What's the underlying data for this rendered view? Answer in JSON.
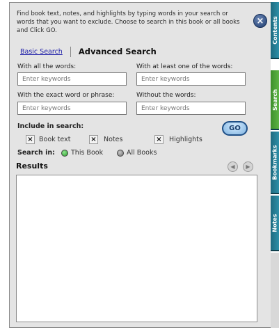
{
  "intro_text": "Find book text, notes, and highlights by typing words in your search or words that you want to exclude. Choose to search in this book or all books and Click GO.",
  "close_label": "×",
  "modes": {
    "basic": "Basic Search",
    "advanced": "Advanced Search"
  },
  "fields": {
    "all_words": {
      "label": "With all the words:",
      "placeholder": "Enter keywords"
    },
    "one_of_words": {
      "label": "With at least one of the words:",
      "placeholder": "Enter keywords"
    },
    "exact_phrase": {
      "label": "With the exact word or phrase:",
      "placeholder": "Enter keywords"
    },
    "without_words": {
      "label": "Without the words:",
      "placeholder": "Enter keywords"
    }
  },
  "include": {
    "label": "Include in search:",
    "options": [
      {
        "label": "Book text",
        "checked": true,
        "mark": "×"
      },
      {
        "label": "Notes",
        "checked": true,
        "mark": "×"
      },
      {
        "label": "Highlights",
        "checked": true,
        "mark": "×"
      }
    ]
  },
  "go_label": "GO",
  "search_in": {
    "label": "Search in:",
    "options": [
      {
        "label": "This Book",
        "selected": true
      },
      {
        "label": "All Books",
        "selected": false
      }
    ]
  },
  "results": {
    "label": "Results",
    "prev_glyph": "◀",
    "next_glyph": "▶"
  },
  "side_tabs": [
    {
      "label": "Contents",
      "active": false
    },
    {
      "label": "Search",
      "active": true
    },
    {
      "label": "Bookmarks",
      "active": false
    },
    {
      "label": "Notes",
      "active": false
    }
  ],
  "colors": {
    "active_tab": "#4ea63a",
    "inactive_tab": "#1e6b80",
    "go_border": "#1f4f86",
    "link": "#2222aa"
  }
}
